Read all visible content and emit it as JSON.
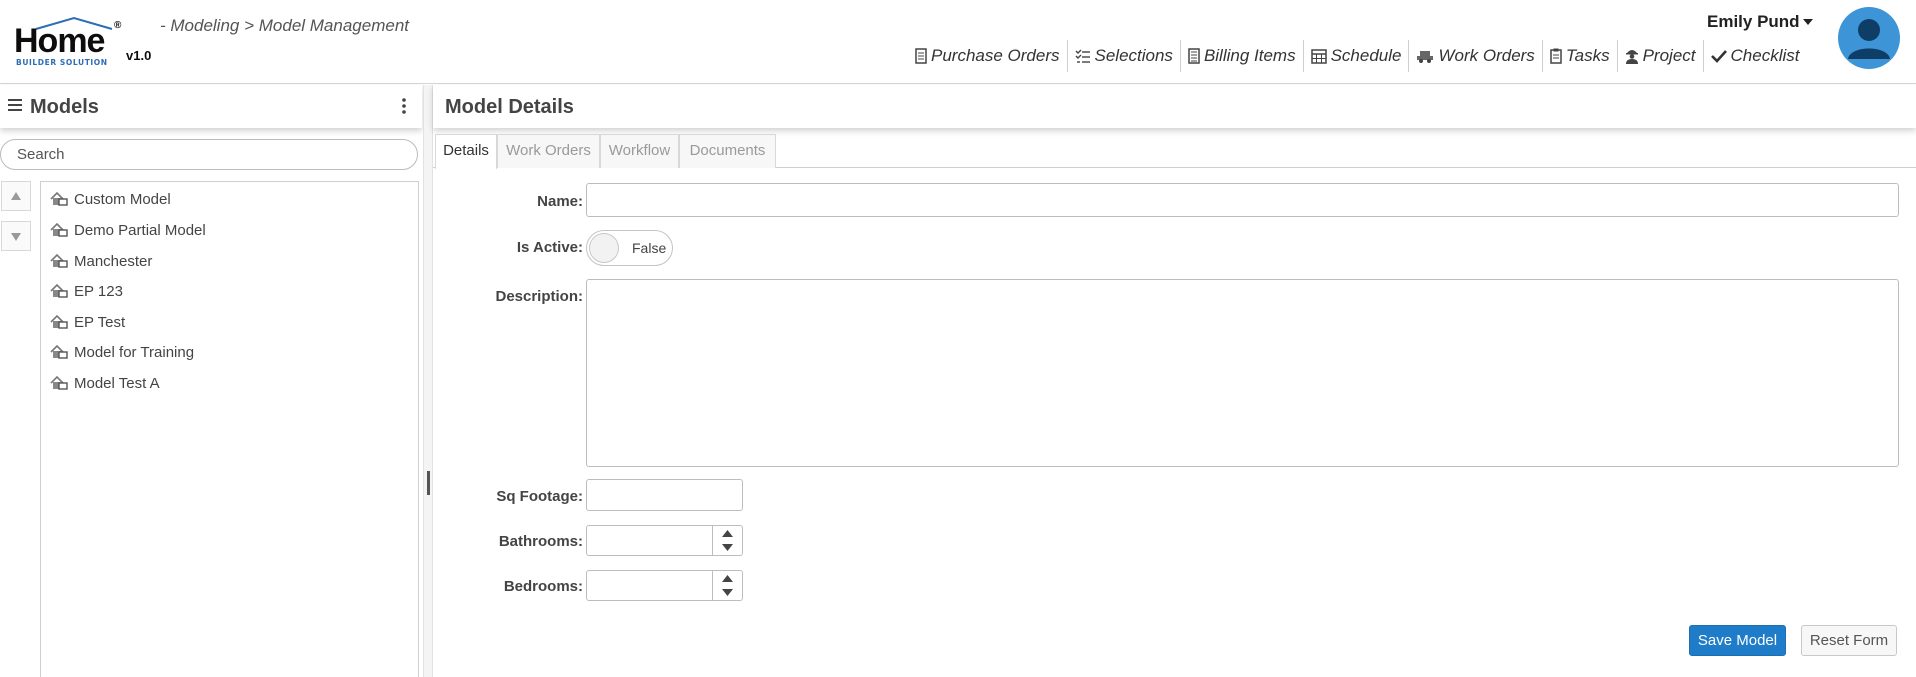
{
  "header": {
    "logo_text": "Home",
    "logo_subtext": "BUILDER SOLUTION",
    "logo_reg": "®",
    "version": "v1.0",
    "breadcrumb": "- Modeling > Model Management",
    "user_name": "Emily Pund"
  },
  "topnav": [
    {
      "label": "Purchase Orders",
      "icon": "document-icon"
    },
    {
      "label": "Selections",
      "icon": "checklist-icon"
    },
    {
      "label": "Billing Items",
      "icon": "list-icon"
    },
    {
      "label": "Schedule",
      "icon": "calendar-icon"
    },
    {
      "label": "Work Orders",
      "icon": "truck-icon"
    },
    {
      "label": "Tasks",
      "icon": "clipboard-icon"
    },
    {
      "label": "Project",
      "icon": "worker-icon"
    },
    {
      "label": "Checklist",
      "icon": "checkmark-icon"
    }
  ],
  "models_panel": {
    "title": "Models",
    "search_placeholder": "Search",
    "items": [
      "Custom Model",
      "Demo Partial Model",
      "Manchester",
      "EP 123",
      "EP Test",
      "Model for Training",
      "Model Test A"
    ]
  },
  "details_panel": {
    "title": "Model Details",
    "tabs": [
      "Details",
      "Work Orders",
      "Workflow",
      "Documents"
    ],
    "active_tab": "Details",
    "form": {
      "name_label": "Name:",
      "name_value": "",
      "is_active_label": "Is Active:",
      "is_active_value": "False",
      "description_label": "Description:",
      "description_value": "",
      "sq_footage_label": "Sq Footage:",
      "sq_footage_value": "",
      "bathrooms_label": "Bathrooms:",
      "bathrooms_value": "",
      "bedrooms_label": "Bedrooms:",
      "bedrooms_value": ""
    },
    "buttons": {
      "save": "Save Model",
      "reset": "Reset Form"
    }
  },
  "colors": {
    "primary": "#1f7cc8",
    "avatar": "#3d94d7",
    "logo_blue": "#2e6db5"
  }
}
